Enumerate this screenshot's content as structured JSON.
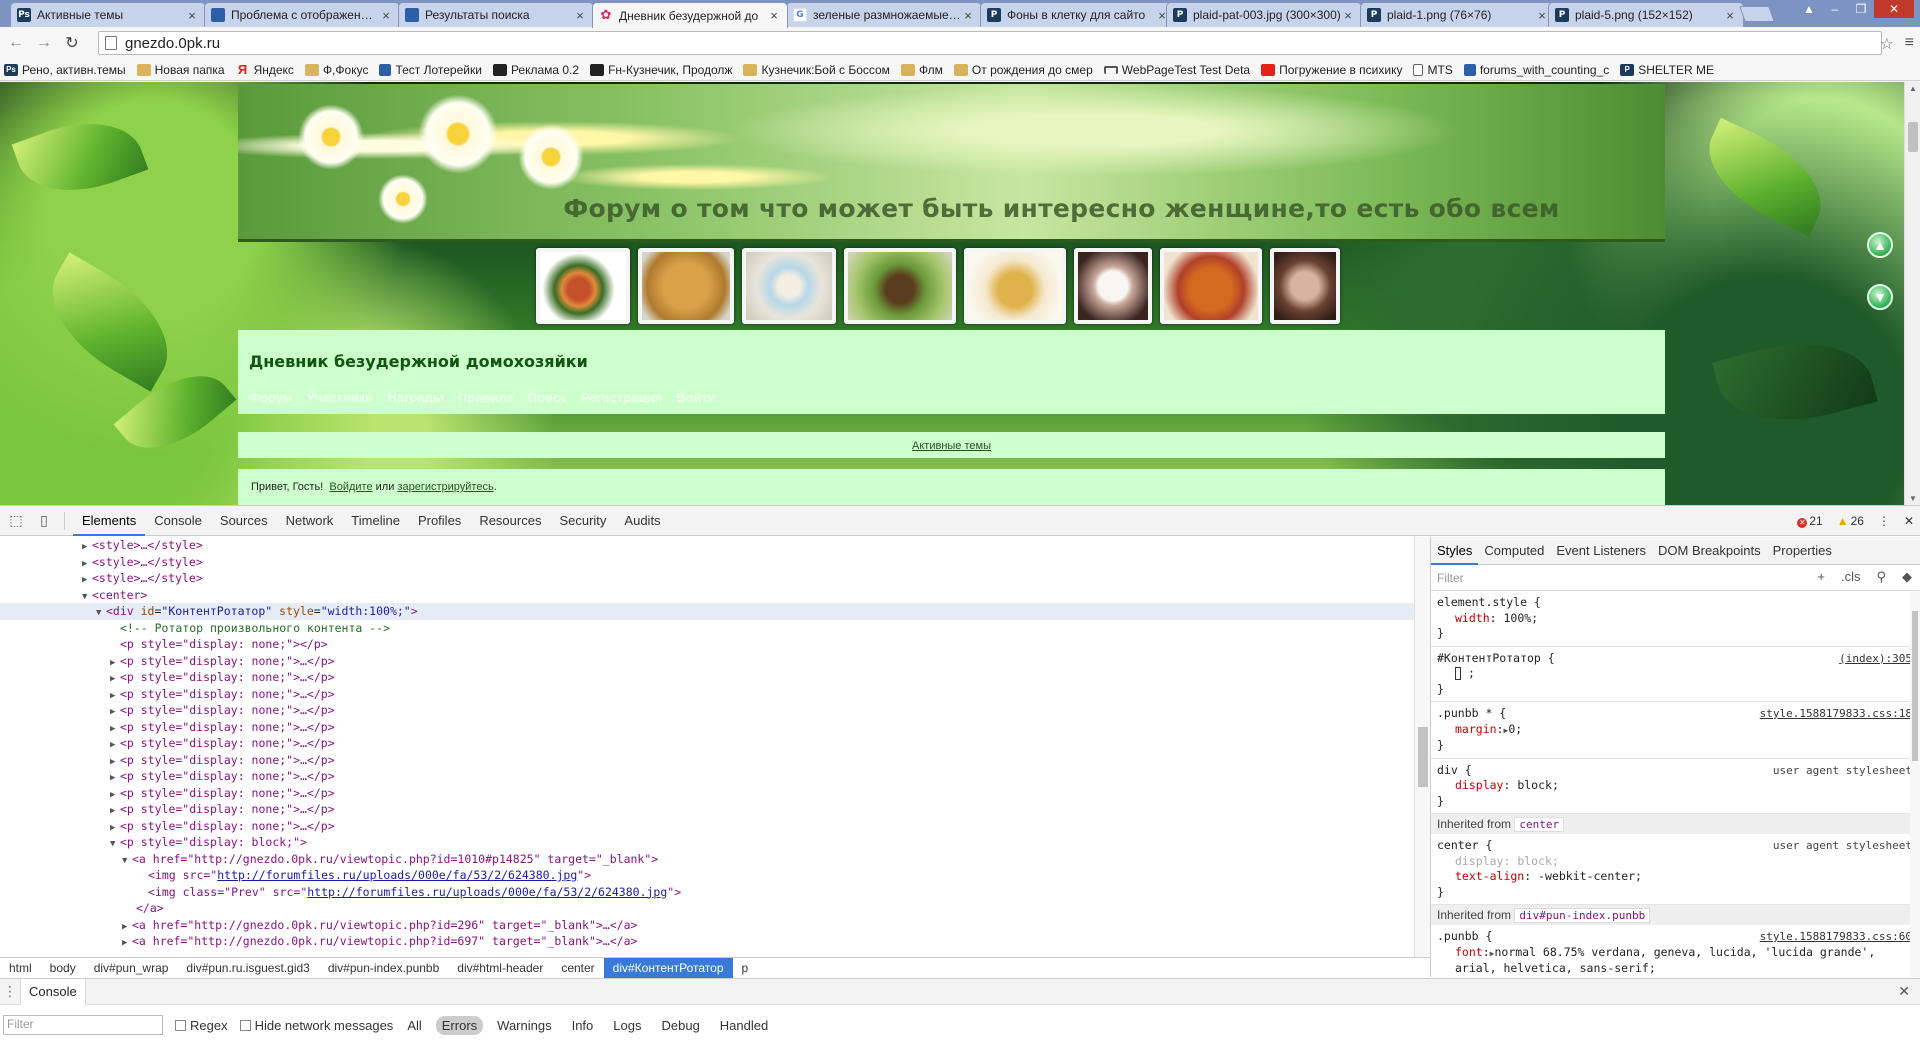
{
  "browser": {
    "tabs": [
      {
        "title": "Активные темы",
        "icon": "photoshop-icon"
      },
      {
        "title": "Проблема с отображением",
        "icon": "chrome-page-icon"
      },
      {
        "title": "Результаты поиска",
        "icon": "chrome-page-icon"
      },
      {
        "title": "Дневник безудержной до",
        "icon": "butterfly-icon",
        "active": true
      },
      {
        "title": "зеленые размножаемые ф",
        "icon": "google-icon"
      },
      {
        "title": "Фоны в клетку для сайто",
        "icon": "psd-icon"
      },
      {
        "title": "plaid-pat-003.jpg (300×300)",
        "icon": "psd-icon"
      },
      {
        "title": "plaid-1.png (76×76)",
        "icon": "psd-icon"
      },
      {
        "title": "plaid-5.png (152×152)",
        "icon": "psd-icon"
      }
    ],
    "url": "gnezdo.0pk.ru",
    "bookmarks": [
      {
        "label": "Рено, активн.темы",
        "icon": "photoshop-icon"
      },
      {
        "label": "Новая папка",
        "icon": "folder-icon"
      },
      {
        "label": "Яндекс",
        "icon": "yandex-icon"
      },
      {
        "label": "Ф,Фокус",
        "icon": "folder-icon"
      },
      {
        "label": "Тест Лотерейки",
        "icon": "chrome-page-icon"
      },
      {
        "label": "Реклама 0.2",
        "icon": "dark-site-icon"
      },
      {
        "label": "Fн-Кузнечик, Продолж",
        "icon": "dark-site-icon"
      },
      {
        "label": "Кузнечик:Бой с Боссом",
        "icon": "folder-icon"
      },
      {
        "label": "Флм",
        "icon": "folder-icon"
      },
      {
        "label": "От рождения до смер",
        "icon": "folder-icon"
      },
      {
        "label": "WebPageTest Test Deta",
        "icon": "gauge-icon"
      },
      {
        "label": "Погружение в психику",
        "icon": "youtube-icon"
      },
      {
        "label": "MTS",
        "icon": "document-icon"
      },
      {
        "label": "forums_with_counting_c",
        "icon": "chrome-page-icon"
      },
      {
        "label": "SHELTER ME",
        "icon": "psd-icon"
      }
    ]
  },
  "page": {
    "banner_title": "Форум о том что может быть интересно женщине,то есть обо всем",
    "forum_title": "Дневник безудержной домохозяйки",
    "nav": [
      "Форум",
      "Участники",
      "Награды",
      "Правила",
      "Поиск",
      "Регистрация",
      "Войти"
    ],
    "active_topics_link": "Активные темы",
    "welcome": {
      "prefix": "Привет, Гость!",
      "login": "Войдите",
      "or": "или",
      "register": "зарегистрируйтесь",
      "suffix": "."
    }
  },
  "devtools": {
    "tabs": [
      "Elements",
      "Console",
      "Sources",
      "Network",
      "Timeline",
      "Profiles",
      "Resources",
      "Security",
      "Audits"
    ],
    "errors": "21",
    "warnings": "26",
    "breadcrumbs": [
      "html",
      "body",
      "div#pun_wrap",
      "div#pun.ru.isguest.gid3",
      "div#pun-index.punbb",
      "div#html-header",
      "center",
      "div#КонтентРотатор",
      "p"
    ],
    "styles_tabs": [
      "Styles",
      "Computed",
      "Event Listeners",
      "DOM Breakpoints",
      "Properties"
    ],
    "styles_filter_placeholder": "Filter",
    "cls_label": ".cls",
    "rules": {
      "element_style": {
        "selector": "element.style {",
        "prop": "width",
        "value": "100%;"
      },
      "rotator": {
        "selector": "#КонтентРотатор {",
        "source": "(index):305",
        "body": ";"
      },
      "punbb_star": {
        "selector": ".punbb * {",
        "source": "style.1588179833.css:18",
        "prop": "margin",
        "value": "0;"
      },
      "div": {
        "selector": "div {",
        "source": "user agent stylesheet",
        "prop": "display",
        "value": "block;"
      },
      "inherited_center": {
        "label": "Inherited from",
        "chip": "center"
      },
      "center": {
        "selector": "center {",
        "source": "user agent stylesheet",
        "prop1": "display",
        "value1": "block;",
        "prop2": "text-align",
        "value2": "-webkit-center;"
      },
      "inherited_punindex": {
        "label": "Inherited from",
        "chip": "div#pun-index.punbb"
      },
      "punbb": {
        "selector": ".punbb {",
        "source": "style.1588179833.css:60",
        "prop": "font",
        "value": "normal 68.75% verdana, geneva, lucida, 'lucida grande', arial, helvetica, sans-serif;"
      },
      "close_brace": "}"
    },
    "console": {
      "tab": "Console",
      "filter_placeholder": "Filter",
      "regex": "Regex",
      "hide_network": "Hide network messages",
      "levels": [
        "All",
        "Errors",
        "Warnings",
        "Info",
        "Logs",
        "Debug",
        "Handled"
      ]
    },
    "code": {
      "style1": "<style>…</style>",
      "style2": "<style>…</style>",
      "style3": "<style>…</style>",
      "center_open": "<center>",
      "div_tag": "<div ",
      "div_id_attr": "id",
      "div_id_val": "\"КонтентРотатор\"",
      "div_style_attr": "style",
      "div_style_val": "\"width:100%;\"",
      "comment": "<!-- Ротатор произвольного контента -->",
      "p_first": "<p style=\"display: none;\"></p>",
      "p_collapsed": "<p style=\"display: none;\">…</p>",
      "p_block_open": "<p style=\"display: block;\">",
      "a1_open": "<a href=\"http://gnezdo.0pk.ru/viewtopic.php?id=1010#p14825\" target=\"_blank\">",
      "img1_prefix": "<img src=\"",
      "img1_url": "http://forumfiles.ru/uploads/000e/fa/53/2/624380.jpg",
      "img1_suffix": "\">",
      "img2_prefix": "<img class=\"Prev\" src=\"",
      "img2_url": "http://forumfiles.ru/uploads/000e/fa/53/2/624380.jpg",
      "img2_suffix": "\">",
      "a_close": "</a>",
      "a2": "<a href=\"http://gnezdo.0pk.ru/viewtopic.php?id=296\" target=\"_blank\">…</a>",
      "a3": "<a href=\"http://gnezdo.0pk.ru/viewtopic.php?id=697\" target=\"_blank\">…</a>"
    }
  }
}
